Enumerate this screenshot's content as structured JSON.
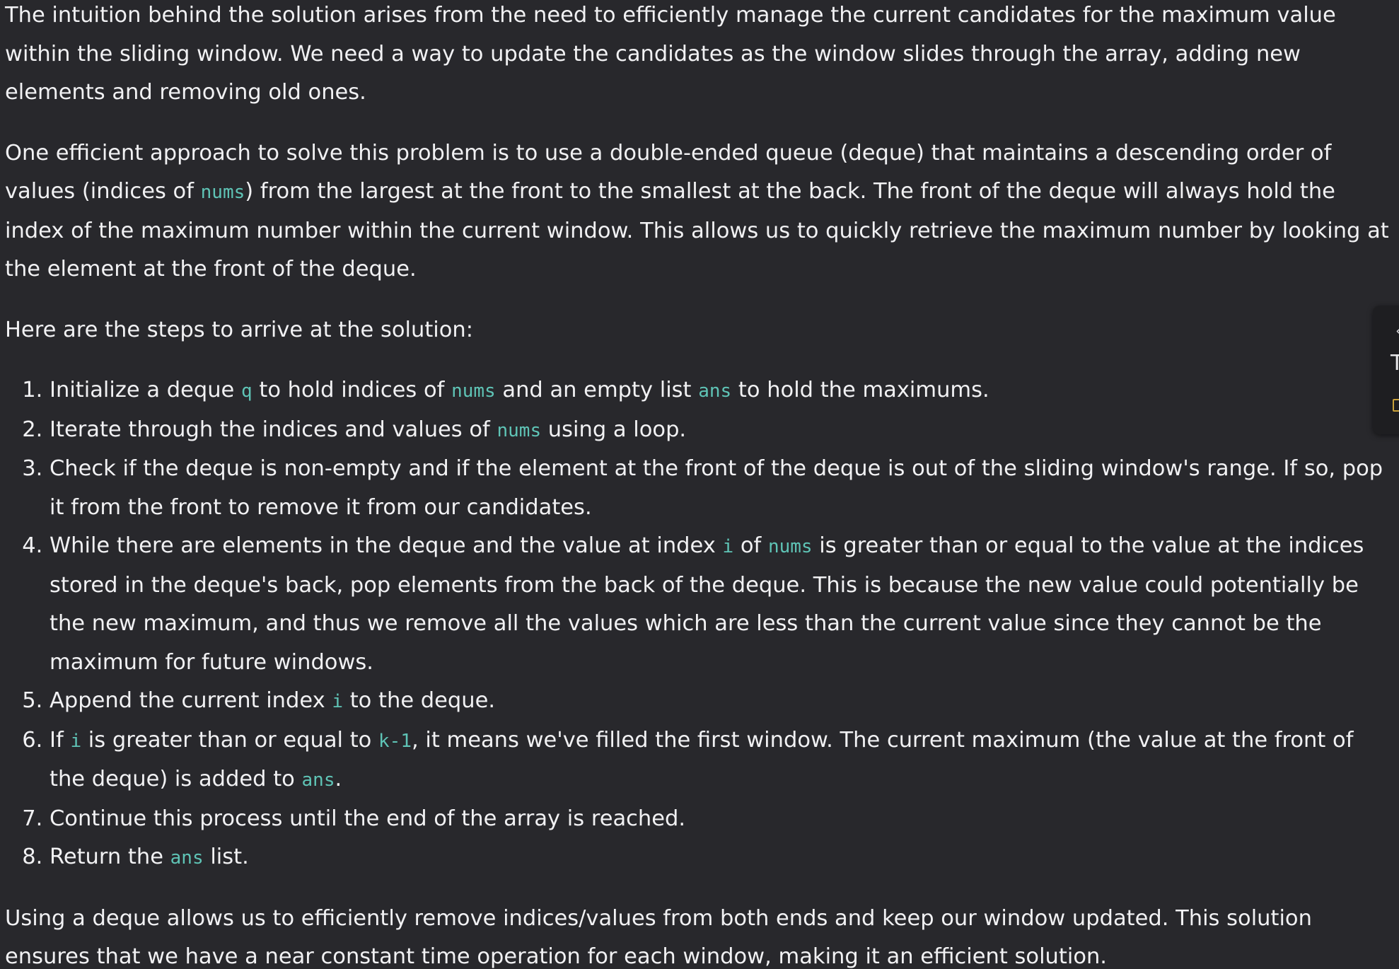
{
  "paragraphs": {
    "intro": "The intuition behind the solution arises from the need to efficiently manage the current candidates for the maximum value within the sliding window. We need a way to update the candidates as the window slides through the array, adding new elements and removing old ones.",
    "approach": {
      "before_nums": "One efficient approach to solve this problem is to use a double-ended queue (deque) that maintains a descending order of values (indices of ",
      "code_nums": "nums",
      "after_nums": ") from the largest at the front to the smallest at the back. The front of the deque will always hold the index of the maximum number within the current window. This allows us to quickly retrieve the maximum number by looking at the element at the front of the deque."
    },
    "steps_intro": "Here are the steps to arrive at the solution:",
    "conclusion": "Using a deque allows us to efficiently remove indices/values from both ends and keep our window updated. This solution ensures that we have a near constant time operation for each window, making it an efficient solution."
  },
  "steps": {
    "s1": {
      "a": "Initialize a deque ",
      "c1": "q",
      "b": " to hold indices of ",
      "c2": "nums",
      "c": " and an empty list ",
      "c3": "ans",
      "d": " to hold the maximums."
    },
    "s2": {
      "a": "Iterate through the indices and values of ",
      "c1": "nums",
      "b": " using a loop."
    },
    "s3": {
      "a": "Check if the deque is non-empty and if the element at the front of the deque is out of the sliding window's range. If so, pop it from the front to remove it from our candidates."
    },
    "s4": {
      "a": "While there are elements in the deque and the value at index ",
      "c1": "i",
      "b": " of ",
      "c2": "nums",
      "c": " is greater than or equal to the value at the indices stored in the deque's back, pop elements from the back of the deque. This is because the new value could potentially be the new maximum, and thus we remove all the values which are less than the current value since they cannot be the maximum for future windows."
    },
    "s5": {
      "a": "Append the current index ",
      "c1": "i",
      "b": " to the deque."
    },
    "s6": {
      "a": "If ",
      "c1": "i",
      "b": " is greater than or equal to ",
      "c2": "k-1",
      "c": ", it means we've filled the first window. The current maximum (the value at the front of the deque) is added to ",
      "c3": "ans",
      "d": "."
    },
    "s7": {
      "a": "Continue this process until the end of the array is reached."
    },
    "s8": {
      "a": "Return the ",
      "c1": "ans",
      "b": " list."
    }
  },
  "side_panel": {
    "chevron_icon": "chevron-left-icon",
    "letter": "T",
    "book_icon": "book-icon"
  },
  "colors": {
    "background": "#28282c",
    "text": "#f1f1f3",
    "inline_code": "#5fc4b6"
  }
}
